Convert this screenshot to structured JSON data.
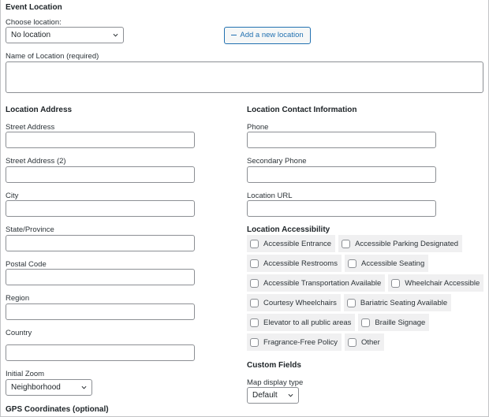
{
  "header": {
    "title": "Event Location"
  },
  "location_select": {
    "label": "Choose location:",
    "value": "No location"
  },
  "add_location_button": {
    "label": "Add a new location",
    "icon": "minus-icon"
  },
  "location_name": {
    "label": "Name of Location (required)",
    "value": ""
  },
  "address": {
    "title": "Location Address",
    "fields": [
      {
        "label": "Street Address",
        "value": ""
      },
      {
        "label": "Street Address (2)",
        "value": ""
      },
      {
        "label": "City",
        "value": ""
      },
      {
        "label": "State/Province",
        "value": ""
      },
      {
        "label": "Postal Code",
        "value": ""
      },
      {
        "label": "Region",
        "value": ""
      },
      {
        "label": "Country",
        "value": ""
      }
    ],
    "initial_zoom": {
      "label": "Initial Zoom",
      "value": "Neighborhood"
    },
    "gps_title": "GPS Coordinates (optional)"
  },
  "contact": {
    "title": "Location Contact Information",
    "fields": [
      {
        "label": "Phone",
        "value": ""
      },
      {
        "label": "Secondary Phone",
        "value": ""
      },
      {
        "label": "Location URL",
        "value": ""
      }
    ]
  },
  "accessibility": {
    "title": "Location Accessibility",
    "options": [
      {
        "label": "Accessible Entrance",
        "checked": false
      },
      {
        "label": "Accessible Parking Designated",
        "checked": false
      },
      {
        "label": "Accessible Restrooms",
        "checked": false
      },
      {
        "label": "Accessible Seating",
        "checked": false
      },
      {
        "label": "Accessible Transportation Available",
        "checked": false
      },
      {
        "label": "Wheelchair Accessible",
        "checked": false
      },
      {
        "label": "Courtesy Wheelchairs",
        "checked": false
      },
      {
        "label": "Bariatric Seating Available",
        "checked": false
      },
      {
        "label": "Elevator to all public areas",
        "checked": false
      },
      {
        "label": "Braille Signage",
        "checked": false
      },
      {
        "label": "Fragrance-Free Policy",
        "checked": false
      },
      {
        "label": "Other",
        "checked": false
      }
    ]
  },
  "custom_fields": {
    "title": "Custom Fields",
    "map_display": {
      "label": "Map display type",
      "value": "Default"
    }
  }
}
